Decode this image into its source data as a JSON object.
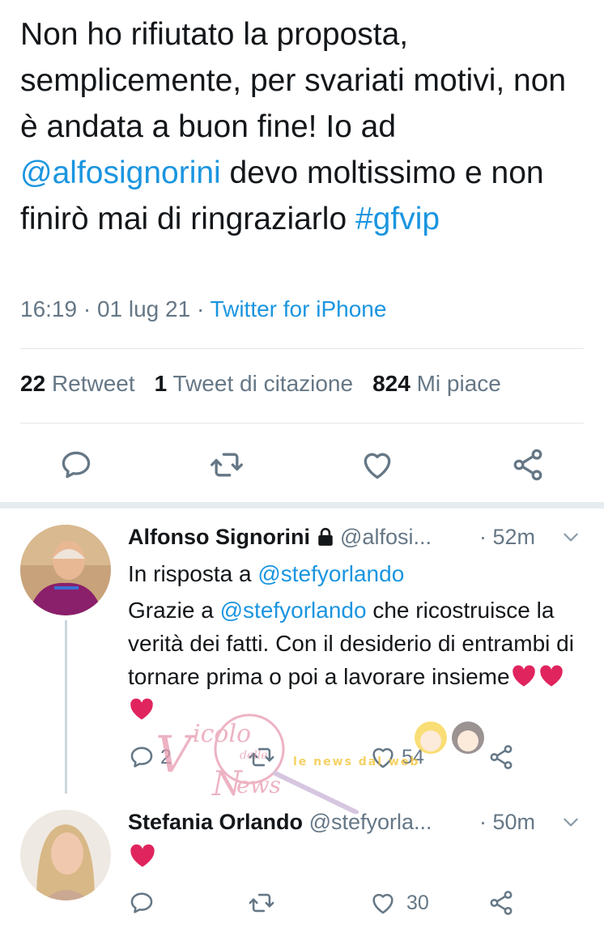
{
  "tweet": {
    "text_before": "Non ho rifiutato la proposta, semplicemente, per svariati motivi, non è andata a buon fine! Io ad ",
    "mention": "@alfosignorini",
    "text_middle": " devo moltissimo e non finirò mai di ringraziarlo ",
    "hashtag": "#gfvip",
    "time": "16:19 · 01 lug 21 · ",
    "source": "Twitter for iPhone"
  },
  "stats": {
    "retweets_count": "22",
    "retweets_label": "Retweet",
    "quotes_count": "1",
    "quotes_label": "Tweet di citazione",
    "likes_count": "824",
    "likes_label": "Mi piace"
  },
  "icons": [
    "reply-icon",
    "retweet-icon",
    "like-icon",
    "share-icon",
    "lock-icon",
    "chevron-down-icon",
    "heart-emoji-icon"
  ],
  "replies": [
    {
      "name": "Alfonso Signorini",
      "handle": "@alfosi...",
      "time": "· 52m",
      "in_reply_prefix": "In risposta a ",
      "in_reply_handle": "@stefyorlando",
      "body_prefix": "Grazie a ",
      "body_mention": "@stefyorlando",
      "body_rest": " che ricostruisce la verità dei fatti. Con il desiderio di entrambi di tornare prima o poi a lavorare insieme",
      "reply_count": "2",
      "like_count": "54"
    },
    {
      "name": "Stefania Orlando",
      "handle": "@stefyorla...",
      "time": "· 50m",
      "like_count": "30"
    }
  ],
  "watermark": {
    "brand_line1": "icolo",
    "brand_line2": "delle",
    "brand_line3": "ews",
    "tagline": "le news dal web"
  },
  "colors": {
    "link": "#1b95e0",
    "muted": "#657786",
    "divider": "#e1e8ed",
    "heart": "#e0245e"
  }
}
